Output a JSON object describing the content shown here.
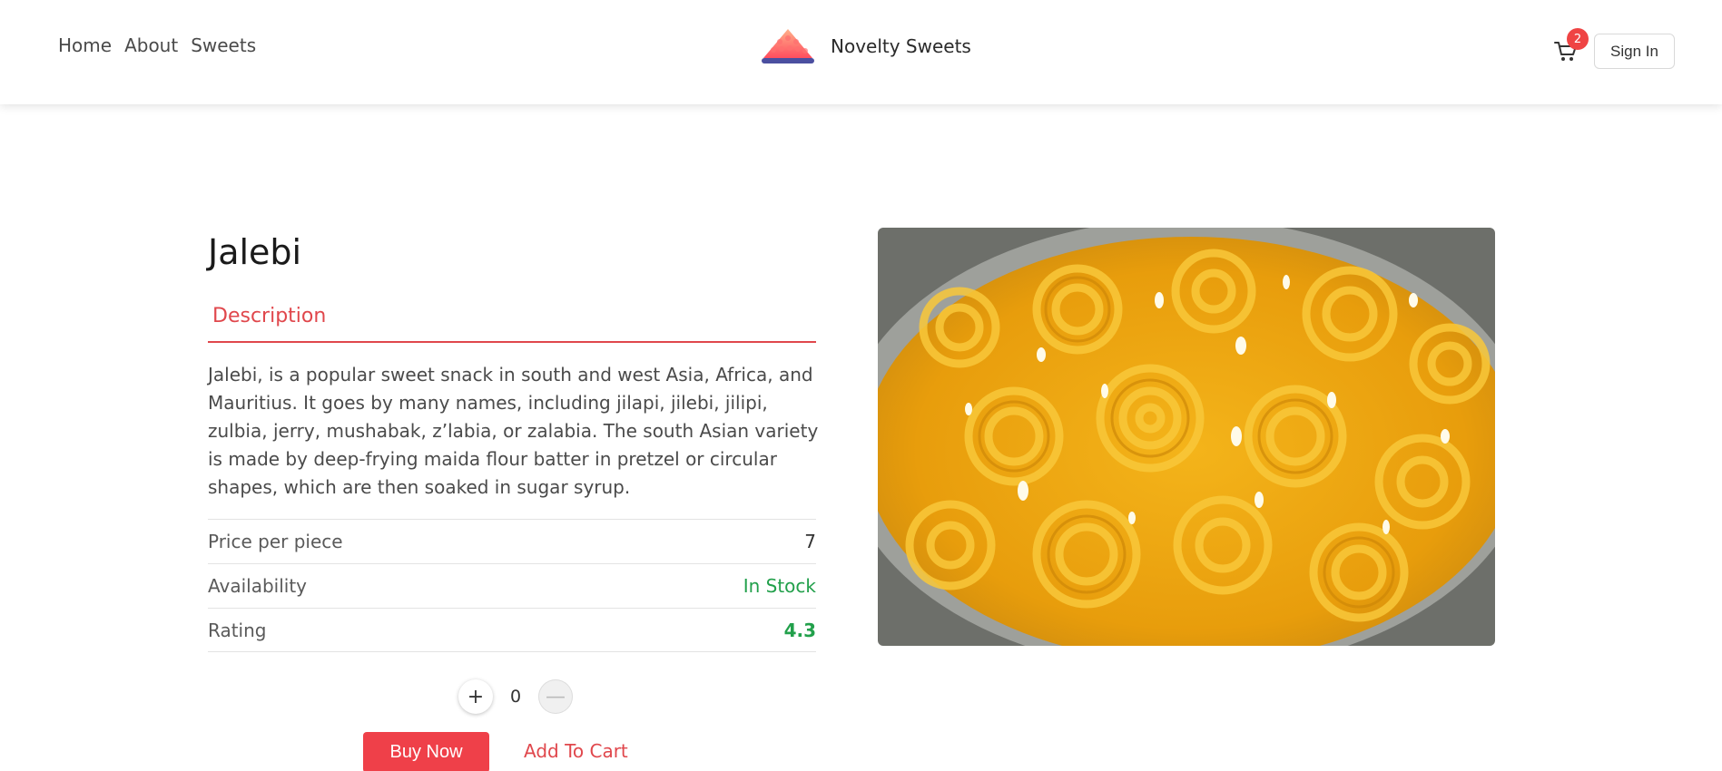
{
  "header": {
    "nav": [
      "Home",
      "About",
      "Sweets"
    ],
    "brand_name": "Novelty Sweets",
    "cart_count": "2",
    "signin_label": "Sign In"
  },
  "product": {
    "title": "Jalebi",
    "tab_label": "Description",
    "description": "Jalebi, is a popular sweet snack in south and west Asia, Africa, and Mauritius. It goes by many names, including jilapi, jilebi, jilipi, zulbia, jerry, mushabak, z’labia, or zalabia. The south Asian variety is made by deep-frying maida flour batter in pretzel or circular shapes, which are then soaked in sugar syrup.",
    "specs": [
      {
        "label": "Price per piece",
        "value": "7"
      },
      {
        "label": "Availability",
        "value": "In Stock"
      },
      {
        "label": "Rating",
        "value": "4.3"
      }
    ]
  },
  "quantity": {
    "plus": "+",
    "value": "0",
    "minus": "—"
  },
  "actions": {
    "buy_now": "Buy Now",
    "add_to_cart": "Add To Cart"
  },
  "colors": {
    "accent": "#e0474c",
    "button": "#ef4049",
    "success": "#22a04b",
    "badge": "#ef4444"
  },
  "icons": {
    "cart": "cart-icon",
    "logo": "mithai-stack-logo"
  }
}
